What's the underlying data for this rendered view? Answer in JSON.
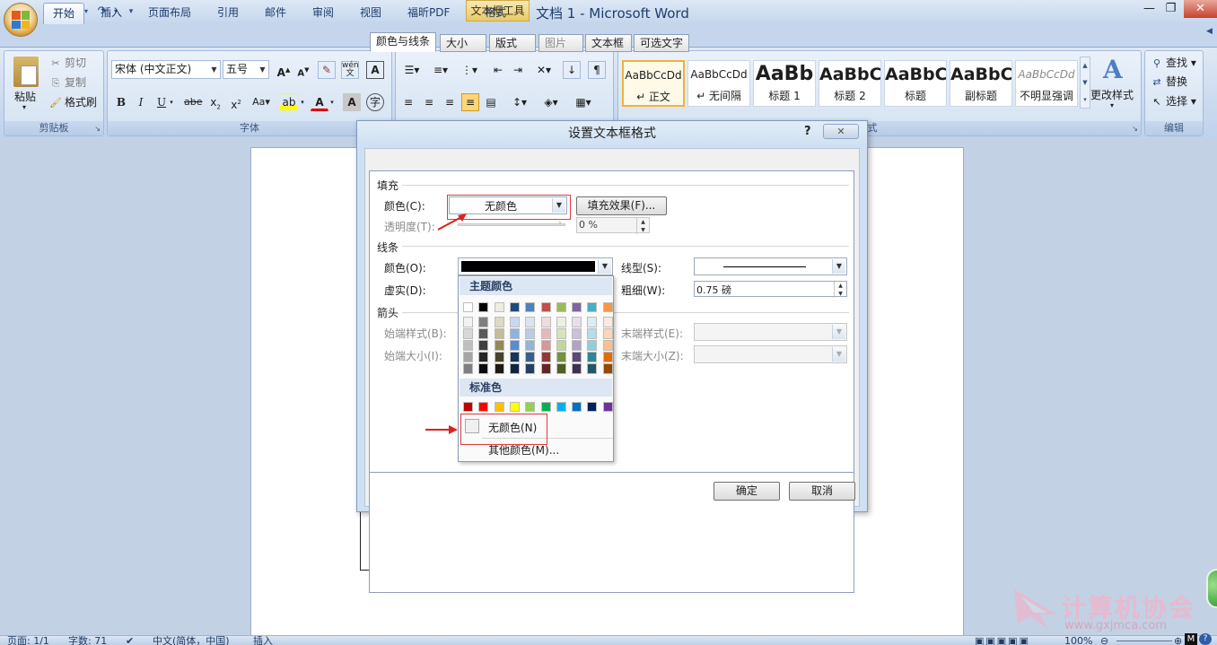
{
  "window": {
    "title": "文档 1 - Microsoft Word",
    "context_tab_label": "文本框工具",
    "minimize_glyph": "—",
    "restore_glyph": "❐",
    "close_glyph": "✕"
  },
  "tabs": [
    "开始",
    "插入",
    "页面布局",
    "引用",
    "邮件",
    "审阅",
    "视图",
    "福昕PDF",
    "格式"
  ],
  "ribbon": {
    "clipboard": {
      "paste": "粘贴",
      "cut": "剪切",
      "copy": "复制",
      "format_painter": "格式刷",
      "label": "剪贴板"
    },
    "font": {
      "font_name": "宋体 (中文正文)",
      "font_size": "五号",
      "label": "字体",
      "pinyin": "wén"
    },
    "styles": {
      "items": [
        {
          "sample": "AaBbCcDd",
          "name": "↵ 正文"
        },
        {
          "sample": "AaBbCcDd",
          "name": "↵ 无间隔"
        },
        {
          "sample": "AaBb",
          "name": "标题 1"
        },
        {
          "sample": "AaBbC",
          "name": "标题 2"
        },
        {
          "sample": "AaBbC",
          "name": "标题"
        },
        {
          "sample": "AaBbC",
          "name": "副标题"
        },
        {
          "sample": "AaBbCcDd",
          "name": "不明显强调"
        }
      ],
      "change_styles": "更改样式",
      "label": "式"
    },
    "editing": {
      "find": "查找",
      "replace": "替换",
      "select": "选择",
      "label": "编辑"
    }
  },
  "dialog": {
    "title": "设置文本框格式",
    "help": "?",
    "tabs": [
      "颜色与线条",
      "大小",
      "版式",
      "图片",
      "文本框",
      "可选文字"
    ],
    "fill": {
      "section": "填充",
      "color_label": "颜色(C):",
      "color_value": "无颜色",
      "fill_effects": "填充效果(F)...",
      "transparency_label": "透明度(T):",
      "transparency_value": "0 %"
    },
    "line": {
      "section": "线条",
      "color_label": "颜色(O):",
      "dash_label": "虚实(D):",
      "style_label": "线型(S):",
      "weight_label": "粗细(W):",
      "weight_value": "0.75 磅"
    },
    "arrows": {
      "section": "箭头",
      "begin_style": "始端样式(B):",
      "begin_size": "始端大小(I):",
      "end_style": "末端样式(E):",
      "end_size": "末端大小(Z):"
    },
    "ok": "确定",
    "cancel": "取消"
  },
  "color_popup": {
    "theme_header": "主题颜色",
    "standard_header": "标准色",
    "no_color": "无颜色(N)",
    "more_colors": "其他颜色(M)...",
    "theme_top": [
      "#ffffff",
      "#000000",
      "#eeece1",
      "#1f497d",
      "#4f81bd",
      "#c0504d",
      "#9bbb59",
      "#8064a2",
      "#4bacc6",
      "#f79646"
    ],
    "theme_shades": [
      [
        "#f2f2f2",
        "#d8d8d8",
        "#bfbfbf",
        "#a5a5a5",
        "#7f7f7f"
      ],
      [
        "#7f7f7f",
        "#595959",
        "#3f3f3f",
        "#262626",
        "#0c0c0c"
      ],
      [
        "#ddd9c3",
        "#c4bd97",
        "#938953",
        "#494429",
        "#1d1b10"
      ],
      [
        "#c6d9f0",
        "#8db3e2",
        "#548dd4",
        "#17365d",
        "#0f243e"
      ],
      [
        "#dbe5f1",
        "#b8cce4",
        "#95b3d7",
        "#366092",
        "#244061"
      ],
      [
        "#f2dcdb",
        "#e5b9b7",
        "#d99694",
        "#953734",
        "#632423"
      ],
      [
        "#ebf1dd",
        "#d7e3bc",
        "#c3d69b",
        "#76923c",
        "#4f6128"
      ],
      [
        "#e5e0ec",
        "#ccc1d9",
        "#b2a2c7",
        "#5f497a",
        "#3f3151"
      ],
      [
        "#dbeef3",
        "#b7dde8",
        "#92cddc",
        "#31859b",
        "#205867"
      ],
      [
        "#fdeada",
        "#fbd5b5",
        "#fac08f",
        "#e36c09",
        "#974806"
      ]
    ],
    "standard": [
      "#c00000",
      "#ff0000",
      "#ffc000",
      "#ffff00",
      "#92d050",
      "#00b050",
      "#00b0f0",
      "#0070c0",
      "#002060",
      "#7030a0"
    ]
  },
  "statusbar": {
    "page": "页面: 1/1",
    "words": "字数: 71",
    "language": "中文(简体，中国)",
    "insert": "插入",
    "zoom": "100%"
  },
  "watermark": {
    "text": "计算机协会",
    "url": "www.gxjmca.com"
  }
}
